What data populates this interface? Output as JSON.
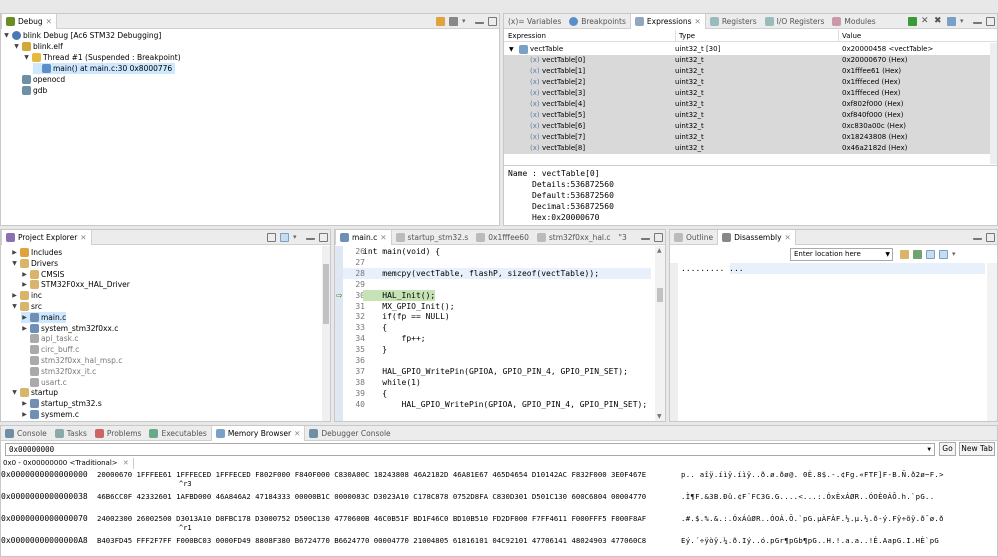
{
  "debug": {
    "tab": "Debug",
    "items": [
      {
        "label": "blink Debug [Ac6 STM32 Debugging]"
      },
      {
        "label": "blink.elf"
      },
      {
        "label": "Thread #1 (Suspended : Breakpoint)"
      },
      {
        "label": "main() at main.c:30 0x8000776"
      },
      {
        "label": "openocd"
      },
      {
        "label": "gdb"
      }
    ]
  },
  "vars": {
    "tabs": [
      "(x)= Variables",
      "Breakpoints",
      "Expressions",
      "Registers",
      "I/O Registers",
      "Modules"
    ],
    "headers": [
      "Expression",
      "Type",
      "Value"
    ],
    "root": {
      "name": "vectTable",
      "type": "uint32_t [30]",
      "value": "0x20000458 <vectTable>"
    },
    "rows": [
      {
        "name": "vectTable[0]",
        "type": "uint32_t",
        "value": "0x20000670 (Hex)"
      },
      {
        "name": "vectTable[1]",
        "type": "uint32_t",
        "value": "0x1fffee61 (Hex)"
      },
      {
        "name": "vectTable[2]",
        "type": "uint32_t",
        "value": "0x1fffeced (Hex)"
      },
      {
        "name": "vectTable[3]",
        "type": "uint32_t",
        "value": "0x1fffeced (Hex)"
      },
      {
        "name": "vectTable[4]",
        "type": "uint32_t",
        "value": "0xf802f000 (Hex)"
      },
      {
        "name": "vectTable[5]",
        "type": "uint32_t",
        "value": "0xf840f000 (Hex)"
      },
      {
        "name": "vectTable[6]",
        "type": "uint32_t",
        "value": "0xc830a00c (Hex)"
      },
      {
        "name": "vectTable[7]",
        "type": "uint32_t",
        "value": "0x18243808 (Hex)"
      },
      {
        "name": "vectTable[8]",
        "type": "uint32_t",
        "value": "0x46a2182d (Hex)"
      }
    ],
    "detail": [
      "Name : vectTable[0]",
      "Details:536872560",
      "Default:536872560",
      "Decimal:536872560",
      "Hex:0x20000670"
    ]
  },
  "explorer": {
    "tab": "Project Explorer",
    "items": [
      {
        "label": "Includes"
      },
      {
        "label": "Drivers"
      },
      {
        "label": "CMSIS"
      },
      {
        "label": "STM32F0xx_HAL_Driver"
      },
      {
        "label": "inc"
      },
      {
        "label": "src"
      },
      {
        "label": "main.c"
      },
      {
        "label": "system_stm32f0xx.c"
      },
      {
        "label": "api_task.c"
      },
      {
        "label": "circ_buff.c"
      },
      {
        "label": "stm32f0xx_hal_msp.c"
      },
      {
        "label": "stm32f0xx_it.c"
      },
      {
        "label": "usart.c"
      },
      {
        "label": "startup"
      },
      {
        "label": "startup_stm32.s"
      },
      {
        "label": "sysmem.c"
      }
    ]
  },
  "editor": {
    "tabs": [
      "main.c",
      "startup_stm32.s",
      "0x1fffee60",
      "stm32f0xx_hal.c",
      "\"3"
    ],
    "lines": [
      {
        "n": "26",
        "code": "int main(void) {"
      },
      {
        "n": "27",
        "code": ""
      },
      {
        "n": "28",
        "code": "    memcpy(vectTable, flashP, sizeof(vectTable));"
      },
      {
        "n": "29",
        "code": ""
      },
      {
        "n": "30",
        "code": "    HAL_Init();"
      },
      {
        "n": "31",
        "code": "    MX_GPIO_Init();"
      },
      {
        "n": "32",
        "code": "    if(fp == NULL)"
      },
      {
        "n": "33",
        "code": "    {"
      },
      {
        "n": "34",
        "code": "        fp++;"
      },
      {
        "n": "35",
        "code": "    }"
      },
      {
        "n": "36",
        "code": ""
      },
      {
        "n": "37",
        "code": "    HAL_GPIO_WritePin(GPIOA, GPIO_PIN_4, GPIO_PIN_SET);"
      },
      {
        "n": "38",
        "code": "    while(1)"
      },
      {
        "n": "39",
        "code": "    {"
      },
      {
        "n": "40",
        "code": "        HAL_GPIO_WritePin(GPIOA, GPIO_PIN_4, GPIO_PIN_SET);"
      }
    ]
  },
  "disasm": {
    "tabs": [
      "Outline",
      "Disassembly"
    ],
    "location_placeholder": "Enter location here",
    "content": "......... ..."
  },
  "console": {
    "tabs": [
      "Console",
      "Tasks",
      "Problems",
      "Executables",
      "Memory Browser",
      "Debugger Console"
    ],
    "address": "0x00000000",
    "go": "Go",
    "newtab": "New Tab",
    "rendering": "0x0 - 0x00000000 <Traditional>",
    "rows": [
      {
        "addr": "0x0000000000000000",
        "hex": "20000670 1FFFEE61 1FFFECED 1FFFECED F802F000 F840F000 C830A00C 18243808 46A2182D 46A81E67 465D4654 D10142AC F832F000 3E0F467E",
        "ascii": "p.. aîÿ.íìÿ.íìÿ..ð.ø.ðø@. 0È.8$.-.¢Fg.«FTF]F-B.Ñ.ð2ø~F.>",
        "note": "^r3"
      },
      {
        "addr": "0x0000000000000038",
        "hex": "46B6CC0F 42332601 1AFBD000 46A846A2 47184333 00000B1C 0000083C D3023A10 C178C878 0752D8FA C830D301 D501C130 600C6804 00004770",
        "ascii": ".Ì¶F.&3B.Ðû.¢F¨FC3G.G....<...:.ÓxÈxÁØR..ÓOÈ0ÁÕ.h.`pG..",
        "note": ""
      },
      {
        "addr": "0x0000000000000070",
        "hex": "24002300 26002500 D3013A10 D8FBC178 D3000752 D500C130 4770600B 46C0B51F BD1F46C0 BD10B510 FD2DF000 F7FF4611 F000FFF5 F000F8AF",
        "ascii": ".#.$.%.&.:.ÓxÁûØR..ÓOÁ.Õ.`pG.µÀFÀF.½.µ.½.ð-ý.Fÿ÷õÿ.ð¯ø.ð",
        "note": "^r1"
      },
      {
        "addr": "0x00000000000000A8",
        "hex": "B403FD45 FFF2F7FF F000BC03 0000FD49 8808F380 B6724770 B6624770 00004770 21004805 61816101 04C92101 47706141 48024903 477060C8",
        "ascii": "Eý.´÷ÿòÿ.¼.ð.Iý..ó.pGr¶pGb¶pG..H.!.a.a..!É.AapG.I.HÈ`pG",
        "note": ""
      }
    ]
  }
}
